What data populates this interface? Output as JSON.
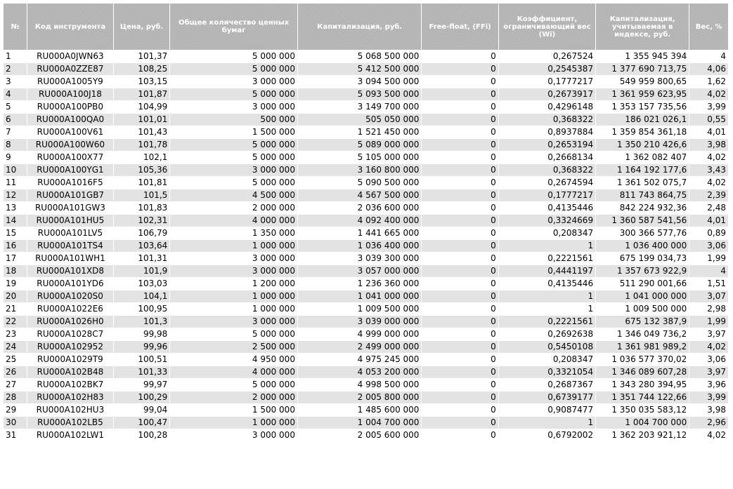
{
  "table": {
    "headers": [
      "№",
      "Код инструмента",
      "Цена, руб.",
      "Общее количество ценных бумаг",
      "Капитализация, руб.",
      "Free-float, (FFi)",
      "Коэффициент, ограничивающий вес (Wi)",
      "Капитализация, учитываемая в индексе, руб.",
      "Вес, %"
    ],
    "rows": [
      [
        "1",
        "RU000A0JWN63",
        "101,37",
        "5 000 000",
        "5 068 500 000",
        "0",
        "0,267524",
        "1 355 945 394",
        "4"
      ],
      [
        "2",
        "RU000A0ZZE87",
        "108,25",
        "5 000 000",
        "5 412 500 000",
        "0",
        "0,2545387",
        "1 377 690 713,75",
        "4,06"
      ],
      [
        "3",
        "RU000A1005Y9",
        "103,15",
        "3 000 000",
        "3 094 500 000",
        "0",
        "0,1777217",
        "549 959 800,65",
        "1,62"
      ],
      [
        "4",
        "RU000A100J18",
        "101,87",
        "5 000 000",
        "5 093 500 000",
        "0",
        "0,2673917",
        "1 361 959 623,95",
        "4,02"
      ],
      [
        "5",
        "RU000A100PB0",
        "104,99",
        "3 000 000",
        "3 149 700 000",
        "0",
        "0,4296148",
        "1 353 157 735,56",
        "3,99"
      ],
      [
        "6",
        "RU000A100QA0",
        "101,01",
        "500 000",
        "505 050 000",
        "0",
        "0,368322",
        "186 021 026,1",
        "0,55"
      ],
      [
        "7",
        "RU000A100V61",
        "101,43",
        "1 500 000",
        "1 521 450 000",
        "0",
        "0,8937884",
        "1 359 854 361,18",
        "4,01"
      ],
      [
        "8",
        "RU000A100W60",
        "101,78",
        "5 000 000",
        "5 089 000 000",
        "0",
        "0,2653194",
        "1 350 210 426,6",
        "3,98"
      ],
      [
        "9",
        "RU000A100X77",
        "102,1",
        "5 000 000",
        "5 105 000 000",
        "0",
        "0,2668134",
        "1 362 082 407",
        "4,02"
      ],
      [
        "10",
        "RU000A100YG1",
        "105,36",
        "3 000 000",
        "3 160 800 000",
        "0",
        "0,368322",
        "1 164 192 177,6",
        "3,43"
      ],
      [
        "11",
        "RU000A1016F5",
        "101,81",
        "5 000 000",
        "5 090 500 000",
        "0",
        "0,2674594",
        "1 361 502 075,7",
        "4,02"
      ],
      [
        "12",
        "RU000A101GB7",
        "101,5",
        "4 500 000",
        "4 567 500 000",
        "0",
        "0,1777217",
        "811 743 864,75",
        "2,39"
      ],
      [
        "13",
        "RU000A101GW3",
        "101,83",
        "2 000 000",
        "2 036 600 000",
        "0",
        "0,4135446",
        "842 224 932,36",
        "2,48"
      ],
      [
        "14",
        "RU000A101HU5",
        "102,31",
        "4 000 000",
        "4 092 400 000",
        "0",
        "0,3324669",
        "1 360 587 541,56",
        "4,01"
      ],
      [
        "15",
        "RU000A101LV5",
        "106,79",
        "1 350 000",
        "1 441 665 000",
        "0",
        "0,208347",
        "300 366 577,76",
        "0,89"
      ],
      [
        "16",
        "RU000A101TS4",
        "103,64",
        "1 000 000",
        "1 036 400 000",
        "0",
        "1",
        "1 036 400 000",
        "3,06"
      ],
      [
        "17",
        "RU000A101WH1",
        "101,31",
        "3 000 000",
        "3 039 300 000",
        "0",
        "0,2221561",
        "675 199 034,73",
        "1,99"
      ],
      [
        "18",
        "RU000A101XD8",
        "101,9",
        "3 000 000",
        "3 057 000 000",
        "0",
        "0,4441197",
        "1 357 673 922,9",
        "4"
      ],
      [
        "19",
        "RU000A101YD6",
        "103,03",
        "1 200 000",
        "1 236 360 000",
        "0",
        "0,4135446",
        "511 290 001,66",
        "1,51"
      ],
      [
        "20",
        "RU000A1020S0",
        "104,1",
        "1 000 000",
        "1 041 000 000",
        "0",
        "1",
        "1 041 000 000",
        "3,07"
      ],
      [
        "21",
        "RU000A1022E6",
        "100,95",
        "1 000 000",
        "1 009 500 000",
        "0",
        "1",
        "1 009 500 000",
        "2,98"
      ],
      [
        "22",
        "RU000A1026H0",
        "101,3",
        "3 000 000",
        "3 039 000 000",
        "0",
        "0,2221561",
        "675 132 387,9",
        "1,99"
      ],
      [
        "23",
        "RU000A1028C7",
        "99,98",
        "5 000 000",
        "4 999 000 000",
        "0",
        "0,2692638",
        "1 346 049 736,2",
        "3,97"
      ],
      [
        "24",
        "RU000A102952",
        "99,96",
        "2 500 000",
        "2 499 000 000",
        "0",
        "0,5450108",
        "1 361 981 989,2",
        "4,02"
      ],
      [
        "25",
        "RU000A1029T9",
        "100,51",
        "4 950 000",
        "4 975 245 000",
        "0",
        "0,208347",
        "1 036 577 370,02",
        "3,06"
      ],
      [
        "26",
        "RU000A102B48",
        "101,33",
        "4 000 000",
        "4 053 200 000",
        "0",
        "0,3321054",
        "1 346 089 607,28",
        "3,97"
      ],
      [
        "27",
        "RU000A102BK7",
        "99,97",
        "5 000 000",
        "4 998 500 000",
        "0",
        "0,2687367",
        "1 343 280 394,95",
        "3,96"
      ],
      [
        "28",
        "RU000A102H83",
        "100,29",
        "2 000 000",
        "2 005 800 000",
        "0",
        "0,6739177",
        "1 351 744 122,66",
        "3,99"
      ],
      [
        "29",
        "RU000A102HU3",
        "99,04",
        "1 500 000",
        "1 485 600 000",
        "0",
        "0,9087477",
        "1 350 035 583,12",
        "3,98"
      ],
      [
        "30",
        "RU000A102LB5",
        "100,47",
        "1 000 000",
        "1 004 700 000",
        "0",
        "1",
        "1 004 700 000",
        "2,96"
      ],
      [
        "31",
        "RU000A102LW1",
        "100,28",
        "3 000 000",
        "2 005 600 000",
        "0",
        "0,6792002",
        "1 362 203 921,12",
        "4,02"
      ]
    ]
  }
}
